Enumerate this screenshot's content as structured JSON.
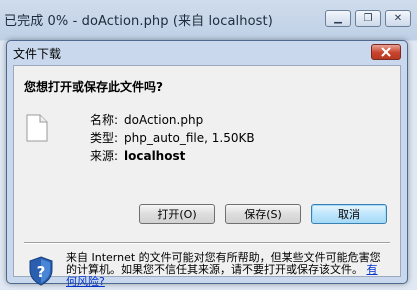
{
  "background_window": {
    "title": "已完成 0% - doAction.php (来自 localhost)",
    "controls": [
      {
        "name": "minimize",
        "symbol": "▁"
      },
      {
        "name": "restore",
        "symbol": "❐"
      },
      {
        "name": "close",
        "symbol": "✕"
      }
    ]
  },
  "dialog": {
    "title": "文件下载",
    "question": "您想打开或保存此文件吗?",
    "fields": [
      {
        "label": "名称:",
        "value": "doAction.php"
      },
      {
        "label": "类型:",
        "value": "php_auto_file, 1.50KB"
      },
      {
        "label": "来源:",
        "value": "localhost"
      }
    ],
    "buttons": {
      "open": "打开(O)",
      "save": "保存(S)",
      "cancel": "取消"
    },
    "warning": {
      "text": "来自 Internet 的文件可能对您有所帮助，但某些文件可能危害您的计算机。如果您不信任其来源，请不要打开或保存该文件。",
      "link": "有何风险?"
    }
  },
  "colors": {
    "dialog_frame": "#c9d8ec",
    "close_button": "#c8432d",
    "link": "#0033cc"
  }
}
